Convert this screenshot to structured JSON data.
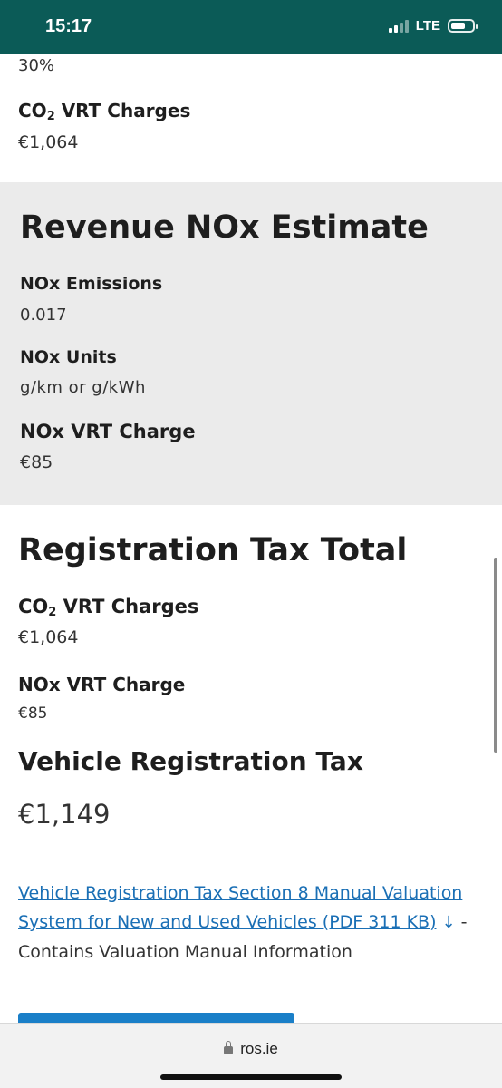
{
  "status_bar": {
    "time": "15:17",
    "network": "LTE"
  },
  "top": {
    "percent": "30%",
    "co2_label_pre": "CO",
    "co2_label_sub": "2",
    "co2_label_post": " VRT Charges",
    "co2_value": "€1,064"
  },
  "nox": {
    "heading": "Revenue NOx Estimate",
    "emissions_label": "NOx Emissions",
    "emissions_value": "0.017",
    "units_label": "NOx Units",
    "units_value": "g/km or g/kWh",
    "charge_label": "NOx VRT Charge",
    "charge_value": "€85"
  },
  "total": {
    "heading": "Registration Tax Total",
    "co2_label_pre": "CO",
    "co2_label_sub": "2",
    "co2_label_post": " VRT Charges",
    "co2_value": "€1,064",
    "nox_label": "NOx VRT Charge",
    "nox_value": "€85",
    "vrt_heading": "Vehicle Registration Tax",
    "vrt_value": "€1,149"
  },
  "manual_link": {
    "link_text": "Vehicle Registration Tax Section 8 Manual Valuation System for New and Used Vehicles (PDF 311 KB)",
    "download_glyph": "↓",
    "suffix": " - Contains Valuation Manual Information"
  },
  "browser": {
    "url": "ros.ie"
  },
  "colors": {
    "status_bar": "#0b5b57",
    "section_bg": "#ebebeb",
    "link": "#1a6fb5",
    "button": "#1a7fc8"
  }
}
